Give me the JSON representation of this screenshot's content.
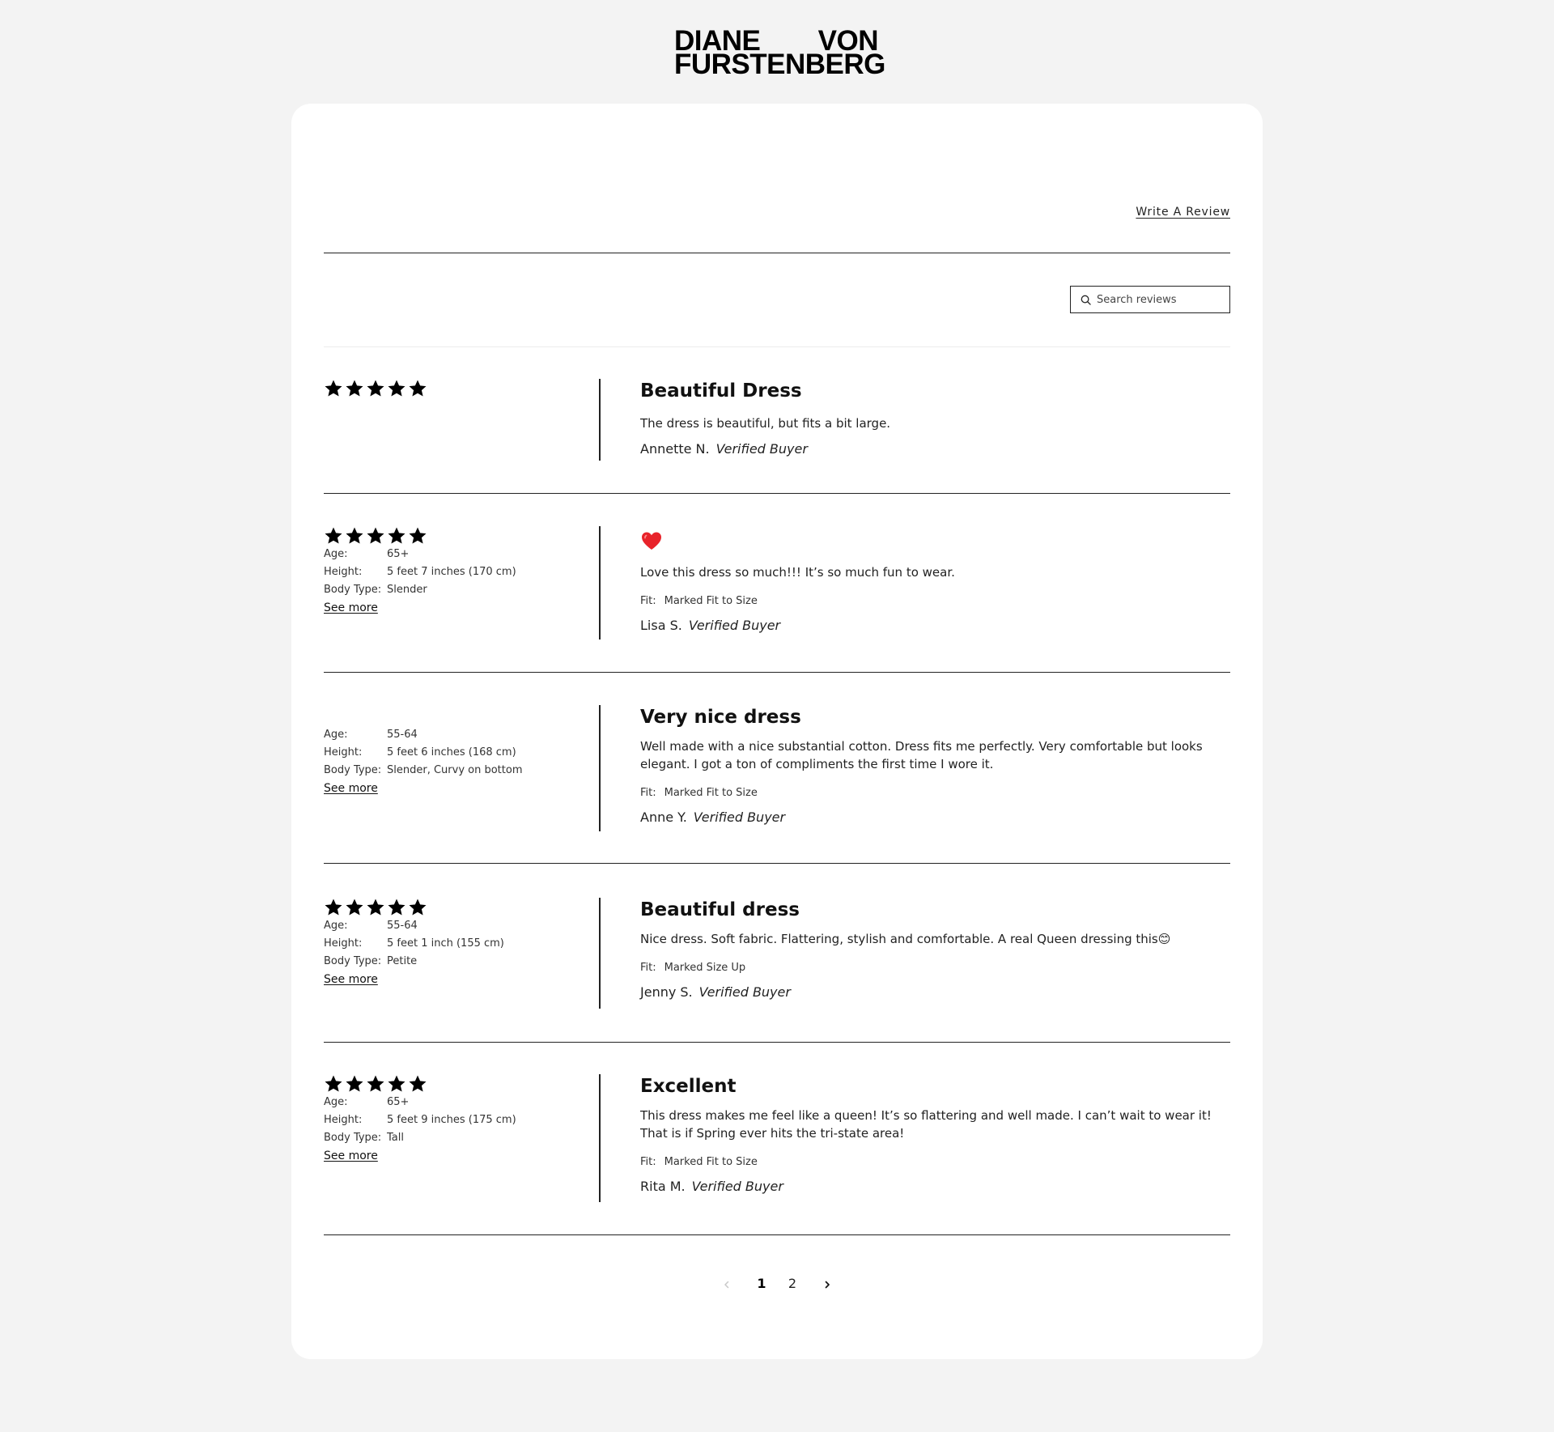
{
  "brand": {
    "line1_left": "DIANE",
    "line1_right": "VON",
    "line2": "FURSTENBERG"
  },
  "toolbar": {
    "write_review_label": "Write A Review"
  },
  "search": {
    "placeholder": "Search reviews",
    "value": ""
  },
  "reviews": [
    {
      "rating": 5,
      "title": "Beautiful Dress",
      "body": "The dress is beautiful, but fits a bit large.",
      "author": "Annette N.",
      "badge": "Verified Buyer"
    },
    {
      "rating": 5,
      "attributes": [
        {
          "key": "Age:",
          "value": "65+"
        },
        {
          "key": "Height:",
          "value": "5 feet 7 inches (170 cm)"
        },
        {
          "key": "Body Type:",
          "value": "Slender"
        }
      ],
      "see_more": "See more",
      "title_icon": "heart-emoji",
      "body": "Love this dress so much!!! It’s so much fun to wear.",
      "fit_label": "Fit:",
      "fit_value": "Marked Fit to Size",
      "author": "Lisa S.",
      "badge": "Verified Buyer"
    },
    {
      "attributes": [
        {
          "key": "Age:",
          "value": "55-64"
        },
        {
          "key": "Height:",
          "value": "5 feet 6 inches (168 cm)"
        },
        {
          "key": "Body Type:",
          "value": "Slender, Curvy on bottom"
        }
      ],
      "see_more": "See more",
      "title": "Very nice dress",
      "body": "Well made with a nice substantial cotton. Dress fits me perfectly. Very comfortable but looks elegant. I got a ton of compliments the first time I wore it.",
      "fit_label": "Fit:",
      "fit_value": "Marked Fit to Size",
      "author": "Anne Y.",
      "badge": "Verified Buyer"
    },
    {
      "rating": 5,
      "attributes": [
        {
          "key": "Age:",
          "value": "55-64"
        },
        {
          "key": "Height:",
          "value": "5 feet 1 inch (155 cm)"
        },
        {
          "key": "Body Type:",
          "value": "Petite"
        }
      ],
      "see_more": "See more",
      "title": "Beautiful dress",
      "body": "Nice dress. Soft fabric. Flattering, stylish and comfortable. A real Queen dressing this😊",
      "fit_label": "Fit:",
      "fit_value": "Marked Size Up",
      "author": "Jenny S.",
      "badge": "Verified Buyer"
    },
    {
      "rating": 5,
      "attributes": [
        {
          "key": "Age:",
          "value": "65+"
        },
        {
          "key": "Height:",
          "value": "5 feet 9 inches (175 cm)"
        },
        {
          "key": "Body Type:",
          "value": "Tall"
        }
      ],
      "see_more": "See more",
      "title": "Excellent",
      "body": "This dress makes me feel like a queen! It’s so flattering and well made. I can’t wait to wear it! That is if Spring ever hits the tri-state area!",
      "fit_label": "Fit:",
      "fit_value": "Marked Fit to Size",
      "author": "Rita M.",
      "badge": "Verified Buyer"
    }
  ],
  "pagination": {
    "pages": [
      "1",
      "2"
    ],
    "current": "1",
    "prev_icon": "chevron-left-icon",
    "next_icon": "chevron-right-icon"
  },
  "colors": {
    "page_bg": "#f3f3f3",
    "card_bg": "#ffffff",
    "text": "#111111",
    "heart": "#e8232a"
  }
}
